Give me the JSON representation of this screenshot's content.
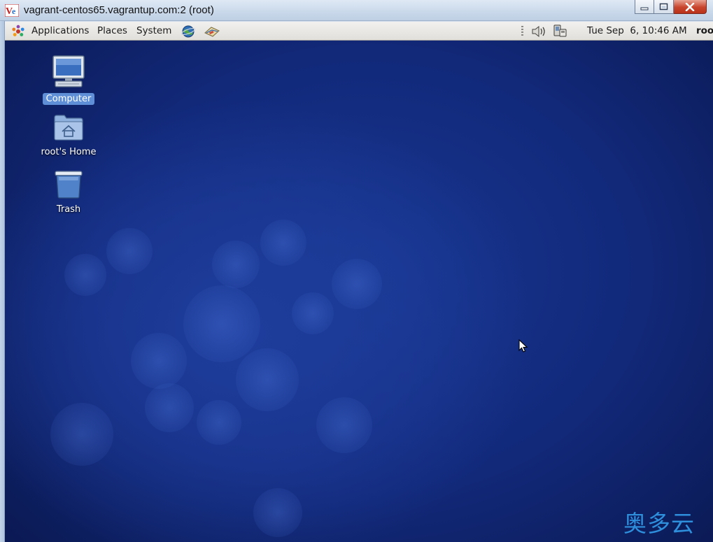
{
  "window": {
    "title": "vagrant-centos65.vagrantup.com:2 (root)",
    "app_icon": "vnc-viewer-icon"
  },
  "panel": {
    "menus": [
      "Applications",
      "Places",
      "System"
    ],
    "launchers": [
      "web-browser-icon",
      "mail-client-icon"
    ],
    "tray": [
      "volume-icon",
      "network-icon"
    ],
    "clock": "Tue Sep  6, 10:46 AM",
    "user": "roo"
  },
  "desktop": {
    "icons": [
      {
        "label": "Computer",
        "icon": "computer-icon",
        "selected": true
      },
      {
        "label": "root's Home",
        "icon": "home-folder-icon",
        "selected": false
      },
      {
        "label": "Trash",
        "icon": "trash-icon",
        "selected": false
      }
    ]
  },
  "watermark": "奥多云",
  "colors": {
    "desktop_base": "#12297a",
    "selection": "#5f8fd6",
    "close_button": "#c8442d",
    "watermark": "#2e8fdc"
  }
}
